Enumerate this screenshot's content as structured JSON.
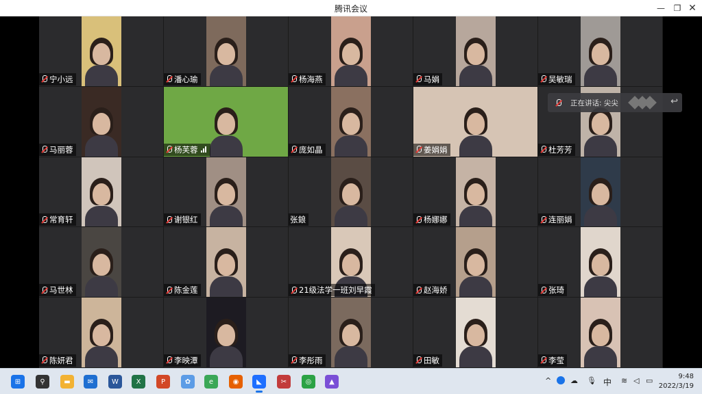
{
  "window": {
    "title": "腾讯会议",
    "min_icon": "minimize-icon",
    "max_icon": "restore-icon",
    "close_icon": "close-icon"
  },
  "participants": [
    {
      "name": "宁小远",
      "muted": true,
      "bg": "#d9c07a"
    },
    {
      "name": "潘心瑜",
      "muted": true,
      "bg": "#7e6a5c"
    },
    {
      "name": "杨海燕",
      "muted": true,
      "bg": "#c9a08d"
    },
    {
      "name": "马娟",
      "muted": true,
      "bg": "#b7a79c"
    },
    {
      "name": "吴敏瑞",
      "muted": true,
      "bg": "#9f9a96"
    },
    {
      "name": "马丽蓉",
      "muted": true,
      "bg": "#3a2a24"
    },
    {
      "name": "杨芙蓉",
      "muted": true,
      "bg": "#6fa845",
      "signal": true,
      "wide": true
    },
    {
      "name": "庞如晶",
      "muted": true,
      "bg": "#8a7060"
    },
    {
      "name": "姜娟娟",
      "muted": true,
      "bg": "#d6c4b4",
      "wide": true
    },
    {
      "name": "杜芳芳",
      "muted": true,
      "bg": "#bfb3a8"
    },
    {
      "name": "常育轩",
      "muted": true,
      "bg": "#d0c5bb"
    },
    {
      "name": "谢银红",
      "muted": true,
      "bg": "#a08f84"
    },
    {
      "name": "张鋃",
      "muted": false,
      "bg": "#5a4c44"
    },
    {
      "name": "杨娜娜",
      "muted": true,
      "bg": "#c5b3a5"
    },
    {
      "name": "连丽娟",
      "muted": true,
      "bg": "#2f3b4a"
    },
    {
      "name": "马世林",
      "muted": true,
      "bg": "#4a4642"
    },
    {
      "name": "陈金莲",
      "muted": true,
      "bg": "#c7b3a1"
    },
    {
      "name": "21级法学一班刘早霞",
      "muted": true,
      "bg": "#d9c8b8"
    },
    {
      "name": "赵海娇",
      "muted": true,
      "bg": "#b59f8c"
    },
    {
      "name": "张琦",
      "muted": true,
      "bg": "#e0d6cc"
    },
    {
      "name": "陈妍君",
      "muted": true,
      "bg": "#cdb59a"
    },
    {
      "name": "李映潭",
      "muted": true,
      "bg": "#1d1b22"
    },
    {
      "name": "李彤雨",
      "muted": true,
      "bg": "#7b6a5e"
    },
    {
      "name": "田敏",
      "muted": true,
      "bg": "#e4dcd3"
    },
    {
      "name": "李莹",
      "muted": true,
      "bg": "#d8c2b4"
    }
  ],
  "speaking": {
    "label": "正在讲话: 尖尖",
    "icon": "mic-muted-icon",
    "back_icon": "return-icon"
  },
  "taskbar": {
    "apps": [
      {
        "name": "start-icon",
        "glyph": "⊞",
        "color": "#1a73e8"
      },
      {
        "name": "search-icon",
        "glyph": "⚲",
        "color": "#333"
      },
      {
        "name": "file-explorer-icon",
        "glyph": "▬",
        "color": "#f2b233"
      },
      {
        "name": "mail-icon",
        "glyph": "✉",
        "color": "#1f6fd1"
      },
      {
        "name": "word-icon",
        "glyph": "W",
        "color": "#2b579a"
      },
      {
        "name": "excel-icon",
        "glyph": "X",
        "color": "#217346"
      },
      {
        "name": "powerpoint-icon",
        "glyph": "P",
        "color": "#d24726"
      },
      {
        "name": "photos-icon",
        "glyph": "✿",
        "color": "#5c9ce6"
      },
      {
        "name": "browser-icon",
        "glyph": "e",
        "color": "#3aa757"
      },
      {
        "name": "firefox-icon",
        "glyph": "◉",
        "color": "#e66000"
      },
      {
        "name": "tencent-meeting-icon",
        "glyph": "◣",
        "color": "#1e6fff",
        "active": true
      },
      {
        "name": "snipping-tool-icon",
        "glyph": "✂",
        "color": "#c23b3b"
      },
      {
        "name": "wechat-icon",
        "glyph": "◎",
        "color": "#2ba245"
      },
      {
        "name": "app-icon",
        "glyph": "▲",
        "color": "#7a4fd6"
      }
    ],
    "tray": {
      "chevron": "^",
      "ime": "中",
      "time": "9:48",
      "date": "2022/3/19"
    }
  },
  "colors": {
    "tile_bg": "#2b2b2d",
    "accent": "#1e6fff"
  }
}
